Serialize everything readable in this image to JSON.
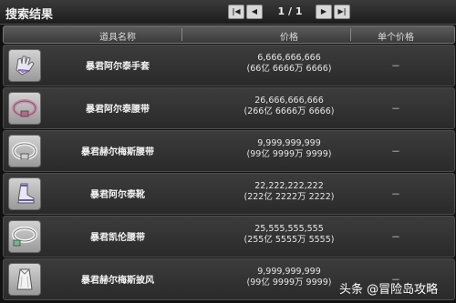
{
  "window": {
    "title": "搜索结果"
  },
  "pager": {
    "first_icon": "first-page-icon",
    "prev_icon": "prev-page-icon",
    "next_icon": "next-page-icon",
    "last_icon": "last-page-icon",
    "page_text": "1 / 1"
  },
  "header": {
    "col_name": "道具名称",
    "col_price": "价格",
    "col_unit": "单个价格"
  },
  "items": [
    {
      "name": "暴君阿尔泰手套",
      "price": "6,666,666,666",
      "price_detail": "(66亿 6666万 6666)",
      "unit_price": "－",
      "icon": "gloves-icon"
    },
    {
      "name": "暴君阿尔泰腰带",
      "price": "26,666,666,666",
      "price_detail": "(266亿 6666万 6666)",
      "unit_price": "－",
      "icon": "belt-icon"
    },
    {
      "name": "暴君赫尔梅斯腰带",
      "price": "9,999,999,999",
      "price_detail": "(99亿 9999万 9999)",
      "unit_price": "－",
      "icon": "belt-icon"
    },
    {
      "name": "暴君阿尔泰靴",
      "price": "22,222,222,222",
      "price_detail": "(222亿 2222万 2222)",
      "unit_price": "－",
      "icon": "boots-icon"
    },
    {
      "name": "暴君凯伦腰带",
      "price": "25,555,555,555",
      "price_detail": "(255亿 5555万 5555)",
      "unit_price": "－",
      "icon": "belt-icon"
    },
    {
      "name": "暴君赫尔梅斯披风",
      "price": "9,999,999,999",
      "price_detail": "(99亿 9999万 9999)",
      "unit_price": "－",
      "icon": "cape-icon"
    }
  ],
  "watermark": "头条 @冒险岛攻略",
  "colors": {
    "row_bg": "#333333",
    "header_bg": "#4a4a4a",
    "title_bg": "#2a2a2a"
  }
}
